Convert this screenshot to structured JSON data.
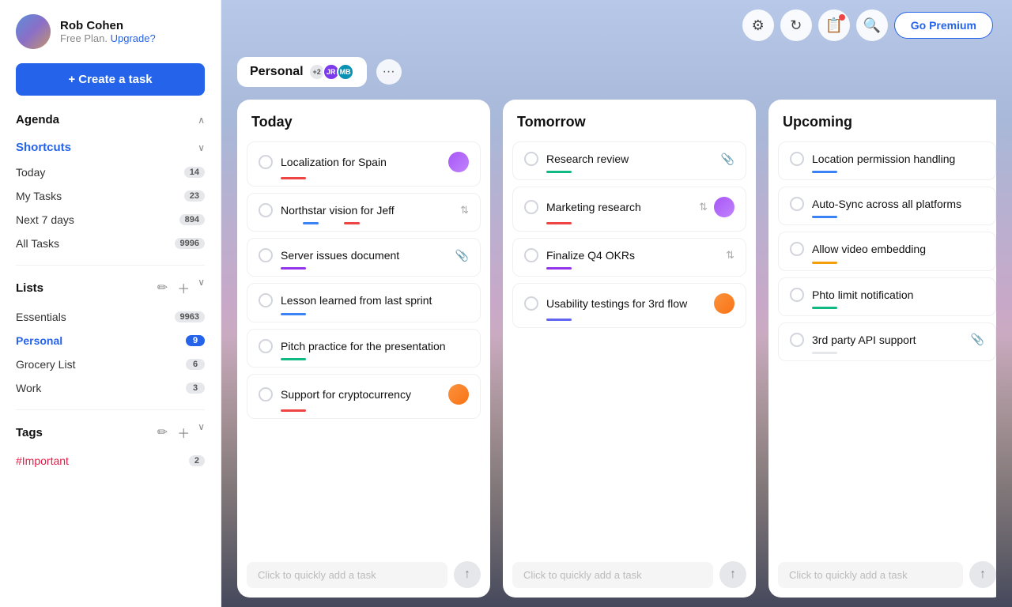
{
  "sidebar": {
    "user": {
      "name": "Rob Cohen",
      "plan": "Free Plan.",
      "upgrade_label": "Upgrade?"
    },
    "create_task_label": "+ Create a task",
    "agenda": {
      "title": "Agenda",
      "chevron": "∧"
    },
    "shortcuts": {
      "title": "Shortcuts",
      "chevron": "∨",
      "items": [
        {
          "label": "Today",
          "badge": "14"
        },
        {
          "label": "My Tasks",
          "badge": "23"
        },
        {
          "label": "Next 7 days",
          "badge": "894"
        },
        {
          "label": "All Tasks",
          "badge": "9996"
        }
      ]
    },
    "lists": {
      "title": "Lists",
      "chevron": "∨",
      "items": [
        {
          "label": "Essentials",
          "badge": "9963",
          "active": false
        },
        {
          "label": "Personal",
          "badge": "9",
          "active": true
        },
        {
          "label": "Grocery List",
          "badge": "6",
          "active": false
        },
        {
          "label": "Work",
          "badge": "3",
          "active": false
        }
      ]
    },
    "tags": {
      "title": "Tags",
      "chevron": "∨",
      "items": [
        {
          "label": "#Important",
          "badge": "2"
        }
      ]
    }
  },
  "topbar": {
    "icons": [
      "⚙",
      "↻",
      "📋",
      "🔍"
    ],
    "go_premium_label": "Go Premium"
  },
  "board": {
    "tab_label": "Personal",
    "avatars": [
      {
        "initials": "JR",
        "color": "#7c3aed"
      },
      {
        "initials": "MB",
        "color": "#0891b2"
      }
    ],
    "avatar_count": "+2",
    "columns": [
      {
        "id": "today",
        "title": "Today",
        "tasks": [
          {
            "id": 1,
            "title": "Localization for Spain",
            "color": "#ef4444",
            "has_avatar": true,
            "avatar_color": "#c084fc",
            "has_attach": false,
            "has_sort": false
          },
          {
            "id": 2,
            "title": "Northstar vision for Jeff",
            "color_left": "#3b82f6",
            "color_right": "#ef4444",
            "dual_color": true,
            "has_avatar": false,
            "has_attach": false,
            "has_sort": true
          },
          {
            "id": 3,
            "title": "Server issues document",
            "color": "#9333ea",
            "has_avatar": false,
            "has_attach": true,
            "has_sort": false
          },
          {
            "id": 4,
            "title": "Lesson learned from last sprint",
            "color": "#3b82f6",
            "has_avatar": false,
            "has_attach": false,
            "has_sort": false
          },
          {
            "id": 5,
            "title": "Pitch practice for the presentation",
            "color": "#10b981",
            "has_avatar": false,
            "has_attach": false,
            "has_sort": false
          },
          {
            "id": 6,
            "title": "Support for cryptocurrency",
            "color": "#ef4444",
            "has_avatar": true,
            "avatar_color": "#f97316",
            "has_attach": false,
            "has_sort": false
          }
        ],
        "quick_add_placeholder": "Click to quickly add a task"
      },
      {
        "id": "tomorrow",
        "title": "Tomorrow",
        "tasks": [
          {
            "id": 7,
            "title": "Research review",
            "color": "#10b981",
            "has_avatar": false,
            "has_attach": true,
            "has_sort": false
          },
          {
            "id": 8,
            "title": "Marketing research",
            "color": "#ef4444",
            "has_avatar": true,
            "avatar_color": "#c084fc",
            "has_attach": false,
            "has_sort": true
          },
          {
            "id": 9,
            "title": "Finalize Q4 OKRs",
            "color": "#9333ea",
            "has_avatar": false,
            "has_attach": false,
            "has_sort": true
          },
          {
            "id": 10,
            "title": "Usability testings for 3rd flow",
            "color": "#6366f1",
            "has_avatar": true,
            "avatar_color": "#f97316",
            "has_attach": false,
            "has_sort": false
          }
        ],
        "quick_add_placeholder": "Click to quickly add a task"
      },
      {
        "id": "upcoming",
        "title": "Upcoming",
        "tasks": [
          {
            "id": 11,
            "title": "Location permission handling",
            "color": "#3b82f6",
            "has_avatar": false,
            "has_attach": false,
            "has_sort": false
          },
          {
            "id": 12,
            "title": "Auto-Sync across all platforms",
            "color": "#3b82f6",
            "has_avatar": false,
            "has_attach": false,
            "has_sort": false
          },
          {
            "id": 13,
            "title": "Allow video embedding",
            "color": "#f59e0b",
            "has_avatar": false,
            "has_attach": false,
            "has_sort": false
          },
          {
            "id": 14,
            "title": "Phto limit notification",
            "color": "#10b981",
            "has_avatar": false,
            "has_attach": false,
            "has_sort": false
          },
          {
            "id": 15,
            "title": "3rd party API support",
            "color": "#e5e7eb",
            "has_avatar": false,
            "has_attach": true,
            "has_sort": false
          }
        ],
        "quick_add_placeholder": "Click to quickly add a task"
      }
    ]
  }
}
